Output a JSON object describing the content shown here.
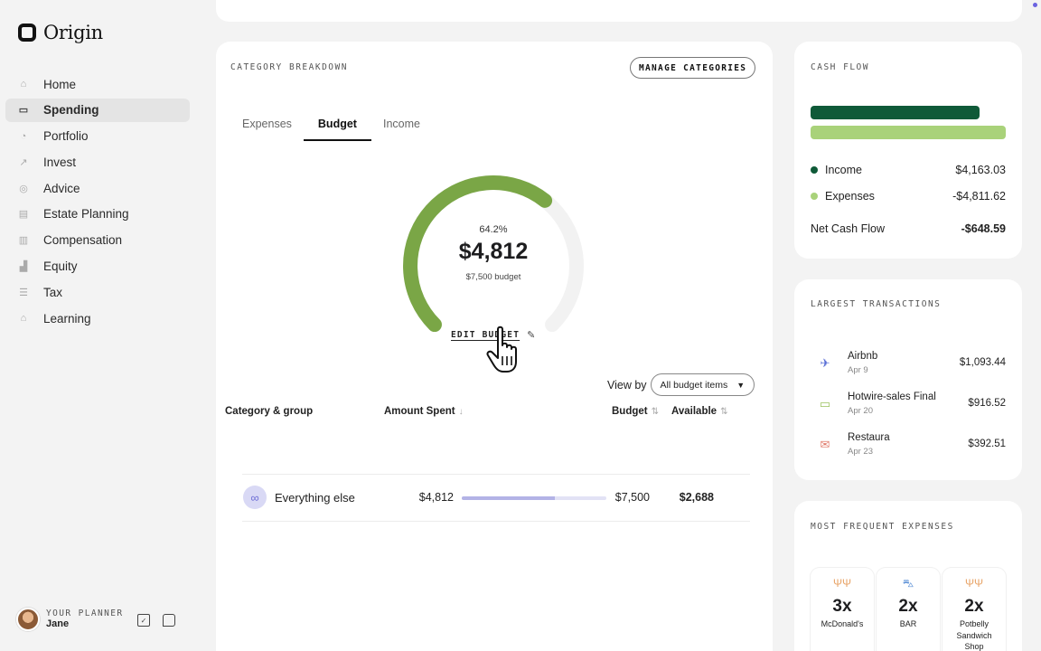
{
  "app": {
    "name": "Origin"
  },
  "sidebar": {
    "items": [
      {
        "label": "Home",
        "icon": "home-icon",
        "active": false
      },
      {
        "label": "Spending",
        "icon": "card-icon",
        "active": true
      },
      {
        "label": "Portfolio",
        "icon": "pie-icon",
        "active": false
      },
      {
        "label": "Invest",
        "icon": "trend-icon",
        "active": false
      },
      {
        "label": "Advice",
        "icon": "target-icon",
        "active": false
      },
      {
        "label": "Estate Planning",
        "icon": "document-icon",
        "active": false
      },
      {
        "label": "Compensation",
        "icon": "building-icon",
        "active": false
      },
      {
        "label": "Equity",
        "icon": "bars-icon",
        "active": false
      },
      {
        "label": "Tax",
        "icon": "receipt-icon",
        "active": false
      },
      {
        "label": "Learning",
        "icon": "graduation-icon",
        "active": false
      }
    ],
    "planner": {
      "label": "YOUR PLANNER",
      "name": "Jane"
    }
  },
  "breakdown": {
    "title": "CATEGORY BREAKDOWN",
    "manage_label": "MANAGE CATEGORIES",
    "tabs": [
      "Expenses",
      "Budget",
      "Income"
    ],
    "active_tab": "Budget",
    "gauge": {
      "percent_label": "64.2%",
      "percent_value": 0.642,
      "amount": "$4,812",
      "budget_label": "$7,500 budget",
      "color": "#7aa646"
    },
    "edit_budget_label": "EDIT BUDGET",
    "view_by": {
      "label": "View by",
      "selected": "All budget items"
    },
    "table": {
      "headers": {
        "category": "Category & group",
        "spent": "Amount Spent",
        "budget": "Budget",
        "available": "Available"
      },
      "rows": [
        {
          "category": "Everything else",
          "spent": "$4,812",
          "progress": 0.642,
          "budget": "$7,500",
          "available": "$2,688"
        }
      ]
    }
  },
  "cash_flow": {
    "title": "CASH FLOW",
    "income_color": "#0f5a38",
    "expenses_color": "#a9d27a",
    "income_ratio": 0.865,
    "income_label": "Income",
    "income_value": "$4,163.03",
    "expenses_label": "Expenses",
    "expenses_value": "-$4,811.62",
    "net_label": "Net Cash Flow",
    "net_value": "-$648.59"
  },
  "largest_transactions": {
    "title": "LARGEST TRANSACTIONS",
    "items": [
      {
        "name": "Airbnb",
        "date": "Apr 9",
        "amount": "$1,093.44",
        "icon": "plane-icon",
        "color": "#5a6fd6"
      },
      {
        "name": "Hotwire-sales Final",
        "date": "Apr 20",
        "amount": "$916.52",
        "icon": "tag-icon",
        "color": "#9cc25f"
      },
      {
        "name": "Restaura",
        "date": "Apr 23",
        "amount": "$392.51",
        "icon": "mail-icon",
        "color": "#e07a6a"
      }
    ]
  },
  "most_frequent": {
    "title": "MOST FREQUENT EXPENSES",
    "items": [
      {
        "count": "3x",
        "name": "McDonald's",
        "icon": "fork-icon",
        "color": "#e8a56a"
      },
      {
        "count": "2x",
        "name": "BAR",
        "icon": "car-icon",
        "color": "#5a8fd6"
      },
      {
        "count": "2x",
        "name": "Potbelly Sandwich Shop",
        "icon": "fork-icon",
        "color": "#e8a56a"
      }
    ]
  }
}
